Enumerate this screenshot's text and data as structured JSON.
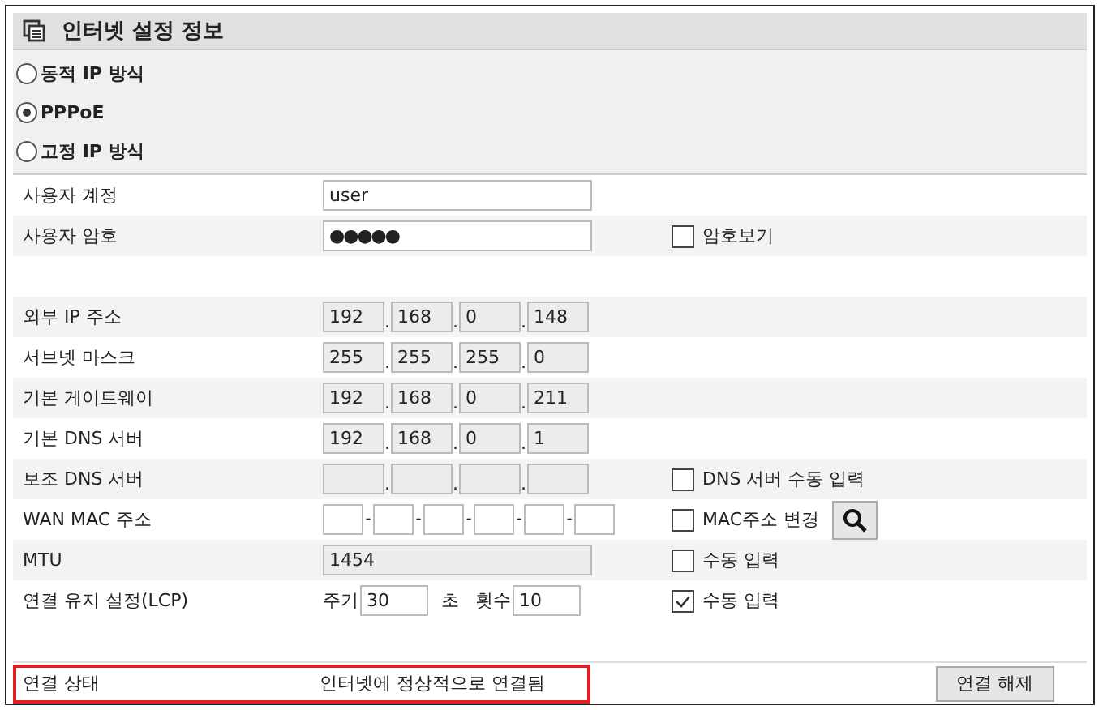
{
  "panel": {
    "title": "인터넷 설정 정보"
  },
  "modes": [
    {
      "label": "동적 IP 방식",
      "selected": false
    },
    {
      "label": "PPPoE",
      "selected": true
    },
    {
      "label": "고정 IP 방식",
      "selected": false
    }
  ],
  "rows": [
    {
      "kind": "text",
      "label": "사용자 계정",
      "value": "user"
    },
    {
      "kind": "password",
      "label": "사용자 암호",
      "value": "●●●●●",
      "option": {
        "label": "암호보기",
        "checked": false
      }
    },
    {
      "kind": "spacer"
    },
    {
      "kind": "ip",
      "label": "외부 IP 주소",
      "disabled": true,
      "separators": [
        ".",
        ".",
        "."
      ],
      "octets": [
        "192",
        "168",
        "0",
        "148"
      ]
    },
    {
      "kind": "ip",
      "label": "서브넷 마스크",
      "disabled": true,
      "separators": [
        ".",
        ".",
        "."
      ],
      "octets": [
        "255",
        "255",
        "255",
        "0"
      ]
    },
    {
      "kind": "ip",
      "label": "기본 게이트웨이",
      "disabled": true,
      "separators": [
        ".",
        ".",
        "."
      ],
      "octets": [
        "192",
        "168",
        "0",
        "211"
      ]
    },
    {
      "kind": "ip",
      "label": "기본 DNS 서버",
      "disabled": true,
      "separators": [
        ".",
        ".",
        "."
      ],
      "octets": [
        "192",
        "168",
        "0",
        "1"
      ]
    },
    {
      "kind": "ip_empty",
      "label": "보조 DNS 서버",
      "disabled": true,
      "separators": [
        ".",
        ".",
        "."
      ],
      "option": {
        "label": "DNS 서버 수동 입력",
        "checked": false
      }
    },
    {
      "kind": "mac",
      "label": "WAN MAC 주소",
      "separators": [
        "-",
        "-",
        "-",
        "-",
        "-"
      ],
      "option": {
        "kind": "checkbox_search",
        "label": "MAC주소 변경",
        "checked": false
      }
    },
    {
      "kind": "plain",
      "label": "MTU",
      "disabled": true,
      "value": "1454",
      "option": {
        "label": "수동 입력",
        "checked": false
      }
    },
    {
      "kind": "lcp",
      "label": "연결 유지 설정(LCP)",
      "period_label": "주기",
      "period": "30",
      "unit": "초",
      "count_label": "횟수",
      "count": "10",
      "option": {
        "label": "수동 입력",
        "checked": true
      }
    },
    {
      "kind": "spacer"
    }
  ],
  "status": {
    "label": "연결 상태",
    "value": "인터넷에 정상적으로 연결됨",
    "highlighted": true,
    "button": "연결 해제"
  }
}
